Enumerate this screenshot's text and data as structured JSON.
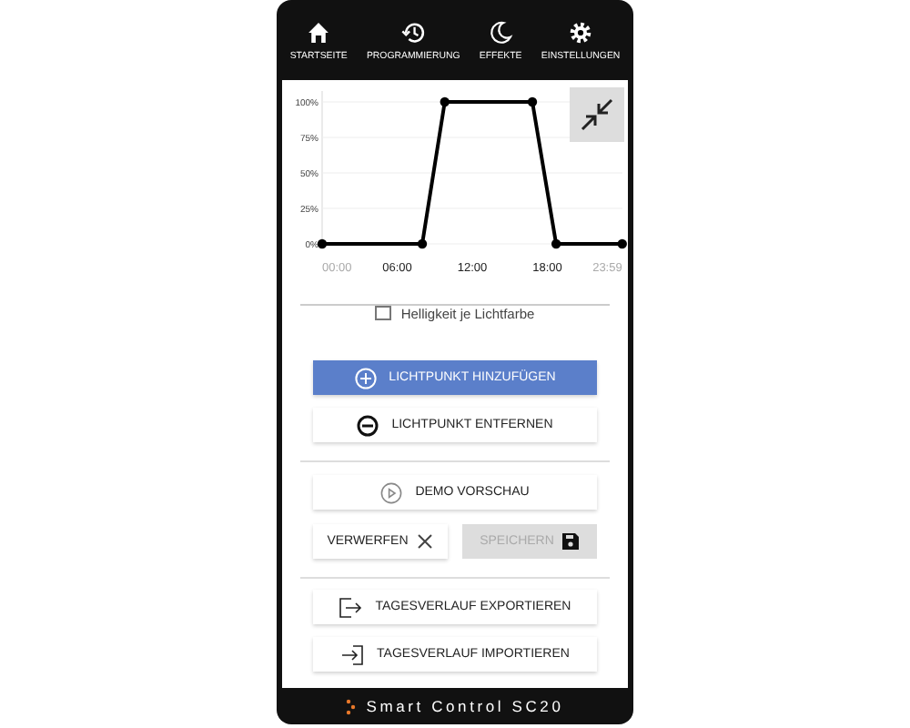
{
  "nav": [
    {
      "label": "STARTSEITE",
      "kind": "home"
    },
    {
      "label": "PROGRAMMIERUNG",
      "kind": "history"
    },
    {
      "label": "EFFEKTE",
      "kind": "moon"
    },
    {
      "label": "EINSTELLUNGEN",
      "kind": "gear"
    }
  ],
  "chart": {
    "chart_data": {
      "type": "line",
      "x": [
        0,
        8,
        9.8,
        16.8,
        18.7,
        23.98
      ],
      "grid": true,
      "series": [
        {
          "color": "#000000",
          "marker": true,
          "values": [
            0,
            0,
            100,
            100,
            0,
            0
          ]
        }
      ],
      "xlim": [
        0,
        24
      ],
      "ylim": [
        0,
        100
      ],
      "xticks": [
        {
          "value": 0,
          "label": "00:00"
        },
        {
          "value": 6,
          "label": "06:00"
        },
        {
          "value": 12,
          "label": "12:00"
        },
        {
          "value": 18,
          "label": "18:00"
        },
        {
          "value": 23.98,
          "label": "23:59"
        }
      ],
      "yticks": [
        {
          "value": 0,
          "label": "0%"
        },
        {
          "value": 25,
          "label": "25%"
        },
        {
          "value": 50,
          "label": "50%"
        },
        {
          "value": 75,
          "label": "75%"
        },
        {
          "value": 100,
          "label": "100%"
        }
      ]
    }
  },
  "checkbox": {
    "label": "Helligkeit je Lichtfarbe",
    "checked": false
  },
  "buttons": [
    {
      "label": "LICHTPUNKT HINZUFÜGEN",
      "kind": "add"
    },
    {
      "label": "LICHTPUNKT ENTFERNEN",
      "kind": "remove"
    },
    {
      "label": "DEMO VORSCHAU",
      "kind": "play"
    }
  ],
  "actions": [
    {
      "label": "VERWERFEN",
      "kind": "discard",
      "disabled": false
    },
    {
      "label": "SPEICHERN",
      "kind": "save",
      "disabled": true
    }
  ],
  "files": [
    {
      "label": "TAGESVERLAUF EXPORTIEREN",
      "kind": "export"
    },
    {
      "label": "TAGESVERLAUF IMPORTIEREN",
      "kind": "import"
    }
  ],
  "footer": {
    "title": "Smart Control SC20"
  }
}
